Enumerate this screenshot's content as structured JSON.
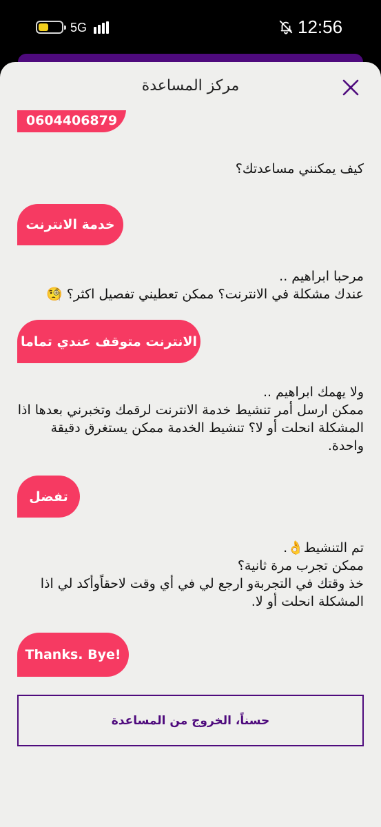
{
  "status_bar": {
    "network": "5G",
    "time": "12:56",
    "battery_level": 0.45
  },
  "sheet": {
    "title": "مركز المساعدة",
    "close_icon": "close-icon"
  },
  "chat": {
    "partial_user_bubble": "0604406879",
    "bot_question": "كيف يمكنني مساعدتك؟",
    "user_1": "خدمة الانترنت",
    "bot_1_line1": "مرحبا ابراهيم ..",
    "bot_1_line2": "عندك مشكلة في الانترنت؟ ممكن تعطيني تفصيل اكثر؟ 🧐",
    "user_2": "الانترنت متوقف عندي تماما",
    "bot_2_line1": "ولا  يهمك ابراهيم ..",
    "bot_2_line2": "ممكن ارسل أمر تنشيط خدمة الانترنت لرقمك وتخبرني بعدها اذا المشكلة انحلت أو لا؟ تنشيط الخدمة ممكن يستغرق دقيقة واحدة.",
    "user_3": "تفضل",
    "bot_3_line1": "تم التنشيط👌.",
    "bot_3_line2": "ممكن تجرب مرة ثانية؟",
    "bot_3_line3": "خذ وقتك في التجربةو ارجع لي في أي وقت لاحقاًوأكد لي اذا المشكلة انحلت أو لا.",
    "user_4": "Thanks. Bye!"
  },
  "exit_button": {
    "label": "حسناً، الخروج من المساعدة"
  },
  "colors": {
    "accent_purple": "#4e0a7d",
    "bubble_pink": "#f63a62",
    "sheet_bg": "#efefed"
  }
}
